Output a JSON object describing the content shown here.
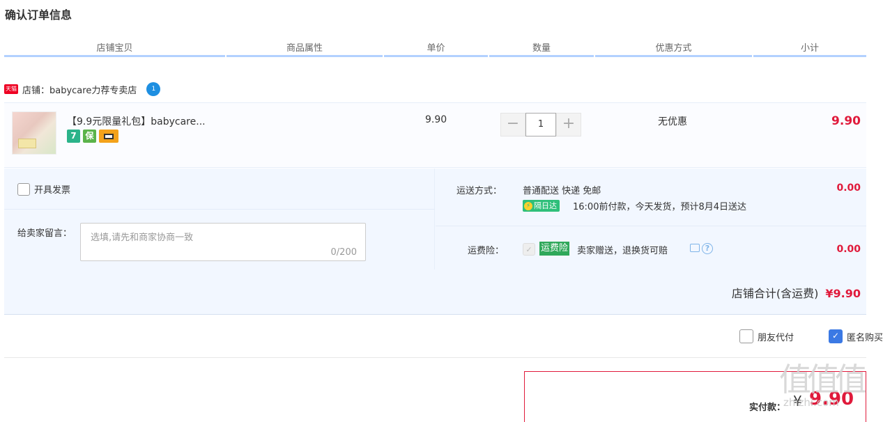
{
  "page": {
    "title": "确认订单信息"
  },
  "columns": [
    "店铺宝贝",
    "商品属性",
    "单价",
    "数量",
    "优惠方式",
    "小计"
  ],
  "shop": {
    "tmall_badge": "天猫",
    "label": "店铺：babycare力荐专卖店",
    "wangwang_icon": "wangwang-chat-icon"
  },
  "item": {
    "name": "【9.9元限量礼包】babycare...",
    "service_badges": [
      "7",
      "保",
      "card"
    ],
    "unit_price": "9.90",
    "quantity": "1",
    "minus": "−",
    "plus": "+",
    "discount": "无优惠",
    "subtotal": "9.90"
  },
  "invoice": {
    "label": "开具发票",
    "checked": false
  },
  "message": {
    "label": "给卖家留言：",
    "placeholder": "选填,请先和商家协商一致",
    "counter": "0/200"
  },
  "shipping": {
    "label": "运送方式：",
    "method": "普通配送 快递 免邮",
    "tag": "隔日达",
    "tag_icon": "⚡",
    "note": "16:00前付款，今天发货，预计8月4日送达",
    "fee": "0.00"
  },
  "insurance": {
    "label": "运费险：",
    "tag": "运费险",
    "text": "卖家赠送，退换货可赔",
    "help_glyph": "?",
    "fee": "0.00"
  },
  "shop_total": {
    "label": "店铺合计(含运费)",
    "amount": "¥9.90"
  },
  "options": {
    "friend_pay": {
      "label": "朋友代付",
      "checked": false
    },
    "anonymous": {
      "label": "匿名购买",
      "checked": true
    }
  },
  "payment": {
    "label": "实付款：",
    "currency": "¥",
    "amount": "9.90"
  },
  "watermark": {
    "glyphs": "值值值",
    "url": "zhizhi.com"
  },
  "colors": {
    "price_red": "#e01a3b",
    "header_line": "#b2d1ff",
    "panel_bg": "#f2f7ff",
    "check_blue": "#3b79e4"
  }
}
